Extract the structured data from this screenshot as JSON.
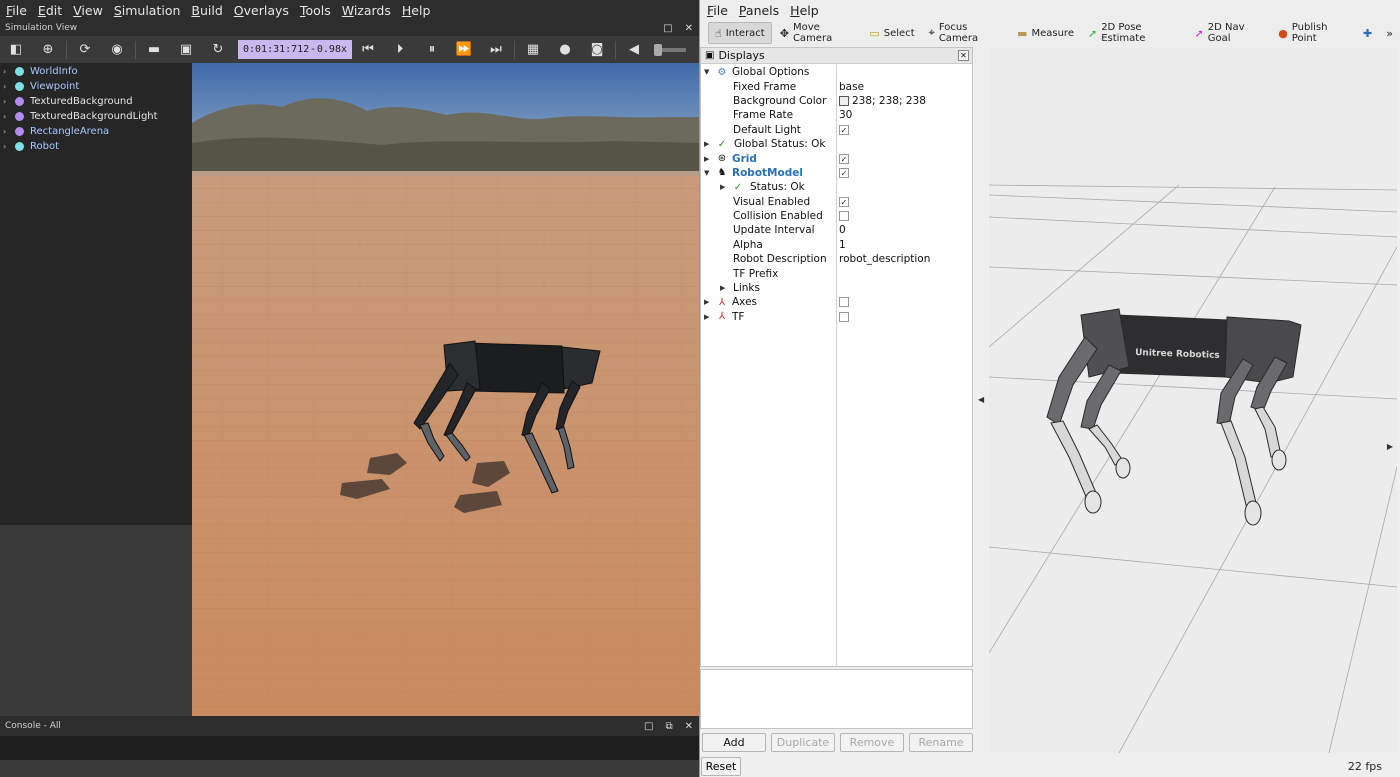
{
  "webots": {
    "menu": [
      "File",
      "Edit",
      "View",
      "Simulation",
      "Build",
      "Overlays",
      "Tools",
      "Wizards",
      "Help"
    ],
    "sim_view_title": "Simulation View",
    "time": "0:01:31:712",
    "time_sep": "-",
    "speed": "0.98x",
    "scene_tree": [
      {
        "label": "WorldInfo",
        "color": "#7fe0e6"
      },
      {
        "label": "Viewpoint",
        "color": "#7fe0e6"
      },
      {
        "label": "TexturedBackground",
        "color": "#b48cf0"
      },
      {
        "label": "TexturedBackgroundLight",
        "color": "#b48cf0"
      },
      {
        "label": "RectangleArena",
        "color": "#b48cf0"
      },
      {
        "label": "Robot",
        "color": "#7fe0e6"
      }
    ],
    "console_title": "Console - All"
  },
  "rviz": {
    "menu": [
      "File",
      "Panels",
      "Help"
    ],
    "tools": [
      {
        "label": "Interact",
        "icon": "hand-icon",
        "glyph": "☝"
      },
      {
        "label": "Move Camera",
        "icon": "move-camera-icon",
        "glyph": "✥"
      },
      {
        "label": "Select",
        "icon": "select-icon",
        "glyph": "▭"
      },
      {
        "label": "Focus Camera",
        "icon": "focus-camera-icon",
        "glyph": "⌖"
      },
      {
        "label": "Measure",
        "icon": "ruler-icon",
        "glyph": "▬"
      },
      {
        "label": "2D Pose Estimate",
        "icon": "pose-estimate-icon",
        "glyph": "➚"
      },
      {
        "label": "2D Nav Goal",
        "icon": "nav-goal-icon",
        "glyph": "➚"
      },
      {
        "label": "Publish Point",
        "icon": "map-pin-icon",
        "glyph": "⬤"
      }
    ],
    "displays_title": "Displays",
    "properties": {
      "global_options": "Global Options",
      "fixed_frame_label": "Fixed Frame",
      "fixed_frame_value": "base",
      "background_color_label": "Background Color",
      "background_color_value": "238; 238; 238",
      "frame_rate_label": "Frame Rate",
      "frame_rate_value": "30",
      "default_light_label": "Default Light",
      "global_status": "Global Status: Ok",
      "grid": "Grid",
      "robot_model": "RobotModel",
      "status_ok": "Status: Ok",
      "visual_enabled_label": "Visual Enabled",
      "collision_enabled_label": "Collision Enabled",
      "update_interval_label": "Update Interval",
      "update_interval_value": "0",
      "alpha_label": "Alpha",
      "alpha_value": "1",
      "robot_description_label": "Robot Description",
      "robot_description_value": "robot_description",
      "tf_prefix_label": "TF Prefix",
      "links": "Links",
      "axes": "Axes",
      "tf": "TF"
    },
    "buttons": {
      "add": "Add",
      "duplicate": "Duplicate",
      "remove": "Remove",
      "rename": "Rename",
      "reset": "Reset"
    },
    "fps": "22 fps",
    "robot_brand": "Unitree Robotics"
  }
}
